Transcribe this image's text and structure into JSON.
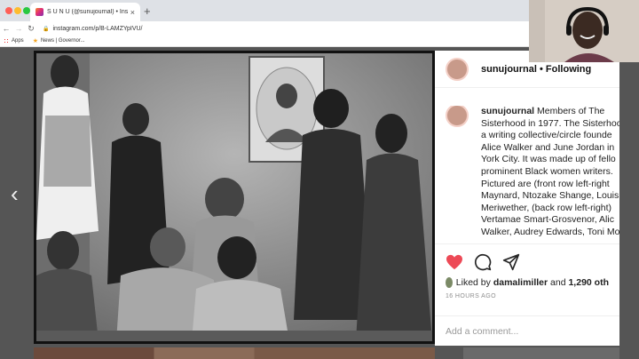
{
  "browser": {
    "tab_title": "S U N U (@sunujournal) • Inst",
    "tab_close": "×",
    "new_tab": "+",
    "url": "instagram.com/p/B-LAMZYpIVU/",
    "bookmarks": [
      {
        "label": "Apps",
        "icon": "apps-grid-icon"
      },
      {
        "label": "News | Governor...",
        "icon": "star-icon"
      }
    ]
  },
  "post": {
    "username": "sunujournal",
    "following": "• Following",
    "caption_user": "sunujournal",
    "caption_lines": [
      "Members of The",
      "Sisterhood in 1977. The Sisterhoo",
      "a writing collective/circle founde",
      "Alice Walker and June Jordan in",
      "York City. It was made up of fello",
      "prominent Black women writers.",
      "Pictured are (front row left-right",
      "Maynard, Ntozake Shange, Louis",
      "Meriwether, (back row left-right)",
      "Vertamae Smart-Grosvenor, Alic",
      "Walker, Audrey Edwards, Toni Mo"
    ],
    "liked_prefix": "Liked by",
    "liked_user": "damalimiller",
    "liked_and": "and",
    "liked_count": "1,290 oth",
    "time_ago": "16 HOURS AGO",
    "comment_placeholder": "Add a comment..."
  },
  "colors": {
    "like_red": "#ed4956"
  }
}
